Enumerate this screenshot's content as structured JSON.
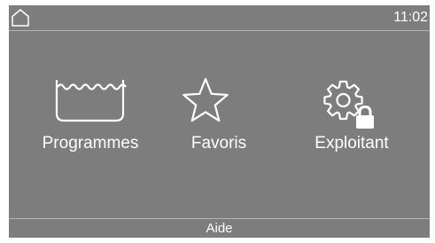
{
  "status_bar": {
    "home_icon": "home-icon",
    "time": "11:02"
  },
  "menu": {
    "items": [
      {
        "label": "Programmes",
        "icon": "wash-tub-icon"
      },
      {
        "label": "Favoris",
        "icon": "star-icon"
      },
      {
        "label": "Exploitant",
        "icon": "gear-lock-icon"
      }
    ]
  },
  "footer": {
    "help_label": "Aide"
  },
  "colors": {
    "screen_background": "#7d7d7d",
    "foreground": "#ffffff",
    "divider": "#b4b4b4"
  }
}
